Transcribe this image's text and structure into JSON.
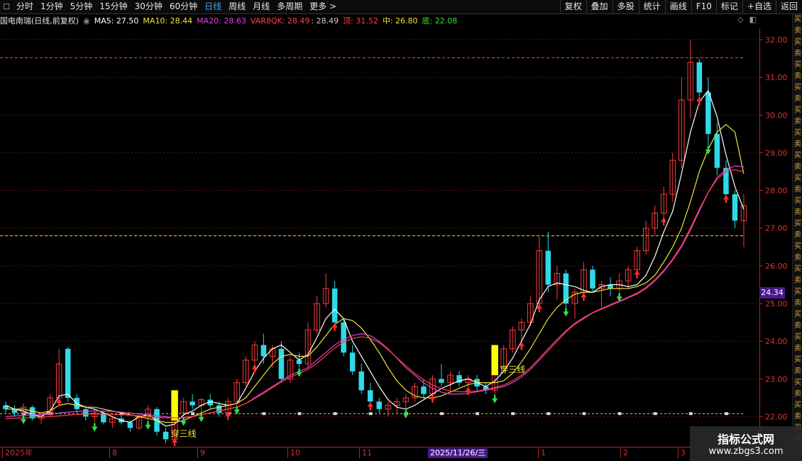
{
  "toolbar": {
    "periods": [
      "分时",
      "1分钟",
      "5分钟",
      "15分钟",
      "30分钟",
      "60分钟",
      "日线",
      "周线",
      "月线",
      "多周期",
      "更多 >"
    ],
    "active_period": "日线",
    "actions": [
      "复权",
      "叠加",
      "多股",
      "统计",
      "画线",
      "F10",
      "标记",
      "+自选",
      "返回"
    ]
  },
  "legend": {
    "title": "国电南瑞(日线,前复权)",
    "ma5": "MA5: 27.50",
    "ma10": "MA10: 28.44",
    "ma20": "MA20: 28.63",
    "var": "VAR8QK: 28.49",
    "var2": ": 28.49",
    "top": "顶: 31.52",
    "mid": "中: 26.80",
    "bottom": "底: 22.08"
  },
  "colors": {
    "up": "#ff3b3b",
    "down": "#2fd9e8",
    "ma5": "#ffffff",
    "ma10": "#f2e33a",
    "ma20": "#e040e0",
    "var": "#ff4040",
    "top_line": "#ff4040",
    "mid_line": "#f2e33a",
    "bottom_line": "#c8e060",
    "signal_bar": "#ffff00",
    "cursor_tag": "#4a1a8a"
  },
  "price_tag": "24.34",
  "side_labels": [
    "买",
    "卖",
    "买",
    "卖",
    "买",
    "卖",
    "买",
    "卖",
    "买",
    "卖",
    "买",
    "卖",
    "买",
    "卖",
    "买",
    "卖",
    "买",
    "卖",
    "买",
    "卖",
    "买",
    "卖",
    "买",
    "卖",
    "买",
    "卖",
    "买",
    "卖",
    "买",
    "卖",
    "买",
    "卖",
    "买",
    "卖",
    "买",
    "卖",
    "买",
    "卖"
  ],
  "date_axis": {
    "labels": [
      "2025年",
      "8",
      "9",
      "10",
      "11",
      "1",
      "2",
      "3"
    ],
    "cursor": "2025/11/26/三"
  },
  "annotations": [
    "穿三线",
    "穿三线"
  ],
  "watermark": {
    "line1": "指标公式网",
    "line2": "www.zbgs3.com"
  },
  "chart_data": {
    "type": "candlestick",
    "y_ticks": [
      "32.00",
      "31.00",
      "30.00",
      "29.00",
      "28.00",
      "27.00",
      "26.00",
      "25.00",
      "24.00",
      "23.00",
      "22.00"
    ],
    "ylim": [
      21.2,
      32.3
    ],
    "levels": {
      "top": 31.52,
      "mid": 26.8,
      "bottom": 22.08
    },
    "series": [
      {
        "name": "MA5",
        "values": [
          22.3,
          22.2,
          22.15,
          22.05,
          22.0,
          22.15,
          22.55,
          22.6,
          22.35,
          22.25,
          22.2,
          22.1,
          22.0,
          21.9,
          21.85,
          22.0,
          22.05,
          21.9,
          21.75,
          21.8,
          22.05,
          22.15,
          22.3,
          22.4,
          22.35,
          22.3,
          22.35,
          22.75,
          23.2,
          23.55,
          23.8,
          23.9,
          23.7,
          23.5,
          23.65,
          24.1,
          24.6,
          24.85,
          24.6,
          24.0,
          23.6,
          23.2,
          22.8,
          22.45,
          22.25,
          22.2,
          22.3,
          22.45,
          22.6,
          22.75,
          22.85,
          22.95,
          23.0,
          22.9,
          22.8,
          22.95,
          23.2,
          23.55,
          24.0,
          24.45,
          25.1,
          25.45,
          25.55,
          25.5,
          25.45,
          25.35,
          25.3,
          25.45,
          25.5,
          25.5,
          25.45,
          25.5,
          25.75,
          26.25,
          26.9,
          27.45,
          28.45,
          29.55,
          30.35,
          30.65,
          29.95,
          28.95,
          28.1,
          27.5
        ]
      },
      {
        "name": "MA10",
        "values": [
          22.2,
          22.2,
          22.2,
          22.15,
          22.1,
          22.15,
          22.3,
          22.35,
          22.3,
          22.25,
          22.25,
          22.2,
          22.15,
          22.1,
          22.05,
          22.0,
          21.95,
          21.9,
          21.85,
          21.85,
          21.9,
          22.0,
          22.1,
          22.2,
          22.25,
          22.3,
          22.35,
          22.5,
          22.8,
          23.1,
          23.4,
          23.6,
          23.65,
          23.6,
          23.6,
          23.85,
          24.15,
          24.45,
          24.6,
          24.55,
          24.35,
          24.05,
          23.7,
          23.3,
          22.95,
          22.7,
          22.55,
          22.5,
          22.5,
          22.55,
          22.65,
          22.75,
          22.85,
          22.9,
          22.9,
          22.9,
          22.95,
          23.15,
          23.45,
          23.8,
          24.2,
          24.6,
          24.9,
          25.1,
          25.25,
          25.3,
          25.3,
          25.35,
          25.4,
          25.4,
          25.4,
          25.45,
          25.55,
          25.75,
          26.1,
          26.5,
          27.0,
          27.7,
          28.5,
          29.1,
          29.55,
          29.75,
          29.55,
          28.44
        ]
      },
      {
        "name": "MA20",
        "values": [
          22.0,
          22.02,
          22.03,
          22.05,
          22.05,
          22.07,
          22.1,
          22.12,
          22.14,
          22.15,
          22.15,
          22.15,
          22.14,
          22.12,
          22.1,
          22.07,
          22.05,
          22.02,
          22.0,
          21.97,
          21.97,
          22.0,
          22.05,
          22.1,
          22.15,
          22.2,
          22.25,
          22.35,
          22.5,
          22.65,
          22.8,
          22.95,
          23.1,
          23.2,
          23.3,
          23.5,
          23.7,
          23.9,
          24.05,
          24.15,
          24.2,
          24.15,
          24.0,
          23.8,
          23.55,
          23.3,
          23.1,
          22.9,
          22.75,
          22.65,
          22.6,
          22.6,
          22.62,
          22.66,
          22.7,
          22.75,
          22.8,
          22.9,
          23.05,
          23.25,
          23.5,
          23.75,
          24.0,
          24.25,
          24.45,
          24.6,
          24.75,
          24.85,
          24.95,
          25.05,
          25.15,
          25.25,
          25.4,
          25.6,
          25.85,
          26.15,
          26.5,
          26.95,
          27.45,
          27.95,
          28.35,
          28.55,
          28.65,
          28.63
        ]
      },
      {
        "name": "VAR8QK",
        "values": [
          21.95,
          21.96,
          21.97,
          21.98,
          21.99,
          22.0,
          22.02,
          22.04,
          22.06,
          22.07,
          22.07,
          22.07,
          22.06,
          22.05,
          22.04,
          22.02,
          22.0,
          21.98,
          21.97,
          21.97,
          21.98,
          22.01,
          22.05,
          22.1,
          22.15,
          22.2,
          22.26,
          22.35,
          22.48,
          22.62,
          22.77,
          22.92,
          23.05,
          23.15,
          23.25,
          23.42,
          23.62,
          23.82,
          23.98,
          24.08,
          24.12,
          24.08,
          23.96,
          23.78,
          23.56,
          23.35,
          23.15,
          22.98,
          22.84,
          22.74,
          22.68,
          22.66,
          22.66,
          22.68,
          22.72,
          22.77,
          22.84,
          22.95,
          23.1,
          23.3,
          23.55,
          23.8,
          24.05,
          24.28,
          24.48,
          24.63,
          24.76,
          24.87,
          24.97,
          25.07,
          25.17,
          25.28,
          25.43,
          25.63,
          25.88,
          26.18,
          26.55,
          27.0,
          27.5,
          27.95,
          28.3,
          28.5,
          28.55,
          28.49
        ]
      }
    ],
    "candles": [
      [
        22.3,
        22.4,
        22.1,
        22.2
      ],
      [
        22.2,
        22.3,
        22.0,
        22.1
      ],
      [
        22.1,
        22.35,
        22.05,
        22.25
      ],
      [
        22.25,
        22.3,
        21.9,
        21.95
      ],
      [
        21.95,
        22.1,
        21.8,
        22.05
      ],
      [
        22.05,
        22.6,
        22.0,
        22.5
      ],
      [
        22.5,
        23.8,
        22.4,
        23.4
      ],
      [
        23.8,
        23.85,
        22.4,
        22.5
      ],
      [
        22.5,
        22.6,
        22.1,
        22.2
      ],
      [
        22.2,
        22.3,
        21.9,
        22.0
      ],
      [
        22.0,
        22.2,
        21.85,
        22.1
      ],
      [
        22.1,
        22.15,
        21.8,
        21.85
      ],
      [
        21.85,
        22.0,
        21.7,
        21.95
      ],
      [
        21.95,
        22.1,
        21.8,
        21.85
      ],
      [
        21.85,
        21.9,
        21.6,
        21.7
      ],
      [
        21.7,
        22.1,
        21.65,
        22.0
      ],
      [
        22.0,
        22.3,
        21.9,
        22.2
      ],
      [
        22.2,
        22.25,
        21.5,
        21.6
      ],
      [
        21.6,
        21.7,
        21.3,
        21.4
      ],
      [
        21.4,
        22.2,
        21.35,
        22.1
      ],
      [
        22.1,
        22.5,
        22.0,
        22.4
      ],
      [
        22.4,
        22.6,
        22.2,
        22.3
      ],
      [
        22.3,
        22.5,
        22.1,
        22.45
      ],
      [
        22.45,
        22.6,
        22.2,
        22.3
      ],
      [
        22.3,
        22.4,
        22.0,
        22.1
      ],
      [
        22.1,
        22.5,
        22.05,
        22.4
      ],
      [
        22.4,
        23.0,
        22.3,
        22.9
      ],
      [
        22.9,
        23.6,
        22.8,
        23.5
      ],
      [
        23.5,
        24.0,
        23.3,
        23.9
      ],
      [
        23.9,
        24.2,
        23.4,
        23.6
      ],
      [
        23.6,
        23.9,
        23.3,
        23.8
      ],
      [
        23.8,
        24.0,
        22.9,
        23.0
      ],
      [
        23.0,
        23.6,
        22.9,
        23.5
      ],
      [
        23.5,
        23.7,
        23.3,
        23.4
      ],
      [
        23.4,
        24.5,
        23.3,
        24.3
      ],
      [
        24.3,
        25.2,
        24.2,
        25.0
      ],
      [
        25.0,
        25.8,
        24.9,
        25.4
      ],
      [
        25.4,
        25.6,
        24.4,
        24.5
      ],
      [
        24.5,
        24.6,
        23.6,
        23.7
      ],
      [
        23.7,
        23.9,
        23.1,
        23.2
      ],
      [
        23.2,
        23.4,
        22.6,
        22.7
      ],
      [
        22.7,
        22.9,
        22.3,
        22.4
      ],
      [
        22.4,
        22.5,
        22.1,
        22.2
      ],
      [
        22.2,
        22.4,
        22.0,
        22.3
      ],
      [
        22.3,
        22.5,
        22.1,
        22.4
      ],
      [
        22.4,
        22.6,
        22.2,
        22.5
      ],
      [
        22.5,
        22.9,
        22.4,
        22.8
      ],
      [
        22.8,
        23.0,
        22.5,
        22.6
      ],
      [
        22.6,
        23.1,
        22.5,
        23.0
      ],
      [
        23.0,
        23.4,
        22.8,
        22.9
      ],
      [
        22.9,
        23.2,
        22.7,
        23.1
      ],
      [
        23.1,
        23.2,
        22.8,
        22.9
      ],
      [
        22.9,
        23.1,
        22.7,
        23.0
      ],
      [
        23.0,
        23.1,
        22.7,
        22.8
      ],
      [
        22.8,
        22.9,
        22.6,
        22.7
      ],
      [
        22.7,
        23.4,
        22.6,
        23.3
      ],
      [
        23.3,
        23.9,
        23.2,
        23.8
      ],
      [
        23.8,
        24.4,
        23.7,
        24.3
      ],
      [
        24.3,
        24.6,
        23.9,
        24.5
      ],
      [
        24.5,
        25.2,
        24.4,
        25.0
      ],
      [
        25.0,
        26.8,
        24.9,
        26.4
      ],
      [
        26.4,
        26.9,
        25.3,
        25.5
      ],
      [
        25.5,
        26.0,
        25.1,
        25.8
      ],
      [
        25.8,
        25.9,
        24.9,
        25.0
      ],
      [
        25.0,
        25.4,
        24.6,
        25.3
      ],
      [
        25.3,
        26.1,
        25.2,
        25.9
      ],
      [
        25.9,
        26.0,
        25.3,
        25.4
      ],
      [
        25.4,
        25.6,
        24.9,
        25.5
      ],
      [
        25.5,
        25.7,
        25.2,
        25.4
      ],
      [
        25.4,
        25.8,
        25.3,
        25.6
      ],
      [
        25.6,
        26.0,
        25.4,
        25.9
      ],
      [
        25.9,
        26.5,
        25.8,
        26.4
      ],
      [
        26.4,
        27.2,
        26.3,
        27.0
      ],
      [
        27.0,
        27.6,
        26.8,
        27.4
      ],
      [
        27.4,
        28.1,
        27.2,
        27.9
      ],
      [
        27.9,
        29.0,
        27.7,
        28.8
      ],
      [
        28.8,
        31.0,
        28.6,
        30.4
      ],
      [
        30.4,
        32.0,
        29.9,
        31.4
      ],
      [
        31.4,
        31.5,
        30.4,
        30.6
      ],
      [
        30.6,
        31.0,
        29.2,
        29.5
      ],
      [
        29.5,
        29.8,
        28.4,
        28.6
      ],
      [
        28.6,
        28.8,
        27.8,
        27.9
      ],
      [
        27.9,
        28.0,
        27.0,
        27.2
      ],
      [
        27.2,
        27.9,
        26.5,
        27.6
      ]
    ],
    "sell_arrows": [
      2,
      10,
      16,
      20,
      22,
      26,
      33,
      45,
      55,
      63,
      69,
      79
    ],
    "buy_arrows": [
      6,
      19,
      25,
      28,
      37,
      41,
      48,
      52,
      58,
      60,
      65,
      71,
      74,
      78,
      81
    ],
    "signal_bars": [
      19,
      55
    ],
    "bottom_markers": [
      2,
      5,
      9,
      13,
      17,
      21,
      25,
      29,
      33,
      37,
      41,
      45,
      49,
      53,
      57,
      61,
      65,
      69,
      73,
      77,
      81
    ],
    "annotation_bars": [
      20,
      57
    ]
  }
}
